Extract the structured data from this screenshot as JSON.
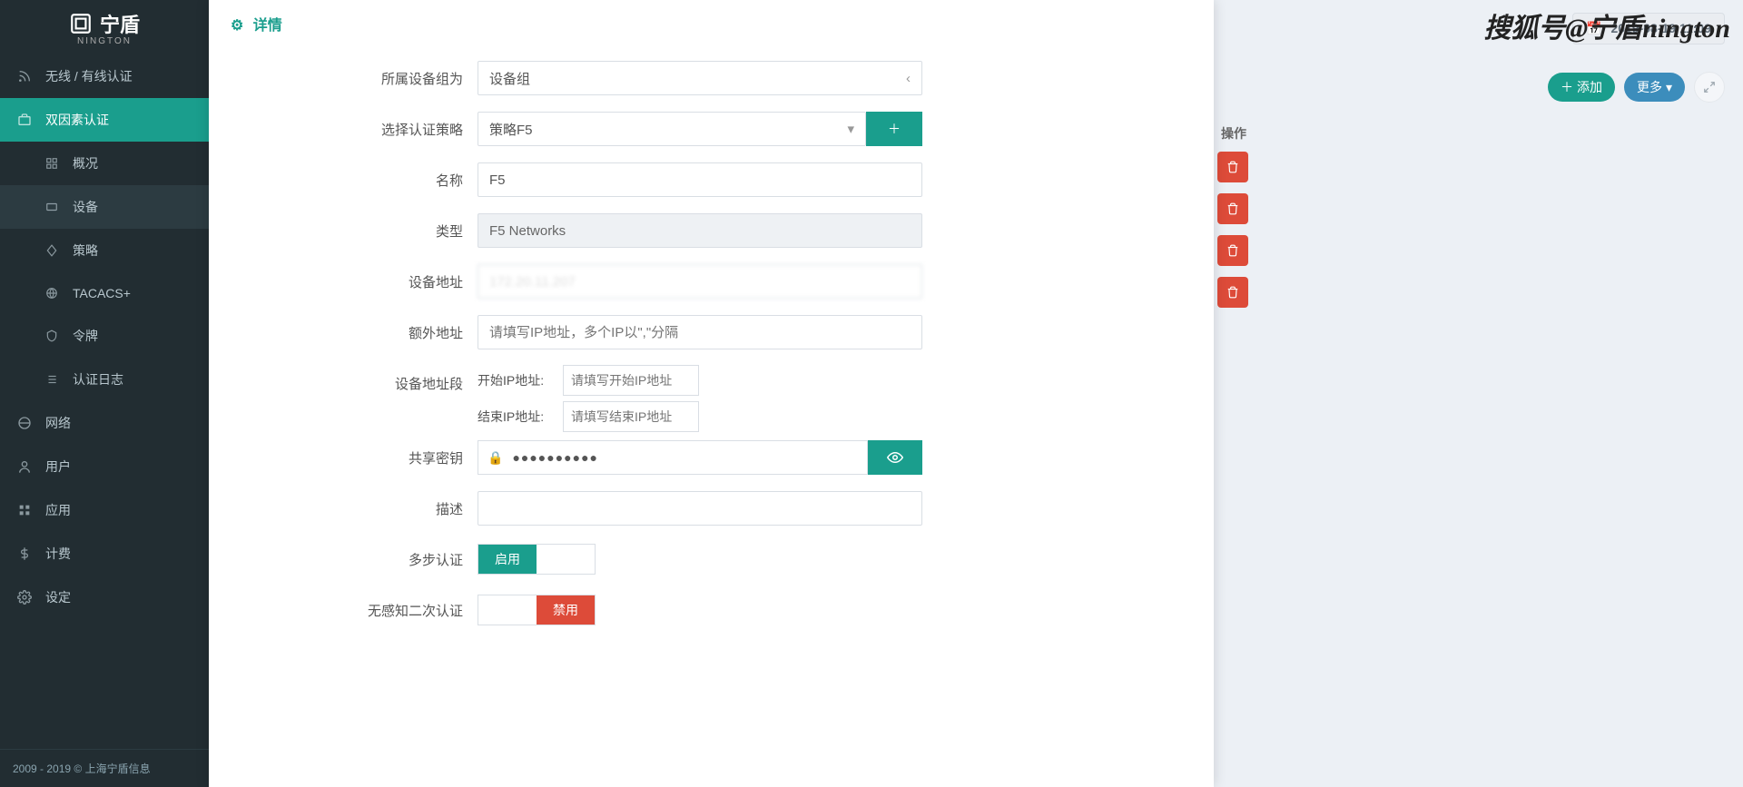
{
  "brand": {
    "name": "宁盾",
    "sub": "NINGTON"
  },
  "watermark": "搜狐号@宁盾nington",
  "sidebar": {
    "top": [
      {
        "label": "无线 / 有线认证"
      },
      {
        "label": "双因素认证"
      }
    ],
    "sub": [
      {
        "label": "概况"
      },
      {
        "label": "设备"
      },
      {
        "label": "策略"
      },
      {
        "label": "TACACS+"
      },
      {
        "label": "令牌"
      },
      {
        "label": "认证日志"
      }
    ],
    "bottom": [
      {
        "label": "网络"
      },
      {
        "label": "用户"
      },
      {
        "label": "应用"
      },
      {
        "label": "计费"
      },
      {
        "label": "设定"
      }
    ],
    "footer": "2009 - 2019 © 上海宁盾信息"
  },
  "header": {
    "timestamp": "2019-08-19 11:09",
    "add_btn": "添加",
    "more_btn": "更多",
    "col_operate": "操作"
  },
  "modal": {
    "title": "详情",
    "labels": {
      "group": "所属设备组为",
      "policy": "选择认证策略",
      "name": "名称",
      "type": "类型",
      "addr": "设备地址",
      "extra_addr": "额外地址",
      "addr_range": "设备地址段",
      "start_ip": "开始IP地址:",
      "end_ip": "结束IP地址:",
      "secret": "共享密钥",
      "desc": "描述",
      "multi": "多步认证",
      "passive": "无感知二次认证"
    },
    "values": {
      "group": "设备组",
      "policy": "策略F5",
      "name": "F5",
      "type": "F5 Networks",
      "addr": "172.20.11.207",
      "secret": "●●●●●●●●●●"
    },
    "placeholders": {
      "extra_addr": "请填写IP地址，多个IP以\",\"分隔",
      "start_ip": "请填写开始IP地址",
      "end_ip": "请填写结束IP地址"
    },
    "toggles": {
      "enable": "启用",
      "disable": "禁用"
    }
  }
}
